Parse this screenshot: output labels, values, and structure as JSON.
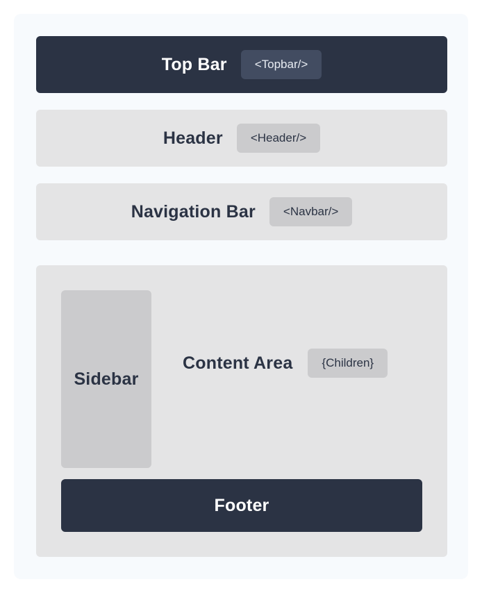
{
  "topbar": {
    "title": "Top Bar",
    "tag": "<Topbar/>"
  },
  "header": {
    "title": "Header",
    "tag": "<Header/>"
  },
  "navbar": {
    "title": "Navigation Bar",
    "tag": "<Navbar/>"
  },
  "main": {
    "sidebar": {
      "title": "Sidebar"
    },
    "content": {
      "title": "Content Area",
      "tag": "{Children}"
    },
    "footer": {
      "title": "Footer"
    }
  },
  "colors": {
    "dark": "#2b3344",
    "light_block": "#e4e4e5",
    "tag_light": "#cbcbcd",
    "tag_dark": "#424c61",
    "background": "#f7fafd"
  }
}
